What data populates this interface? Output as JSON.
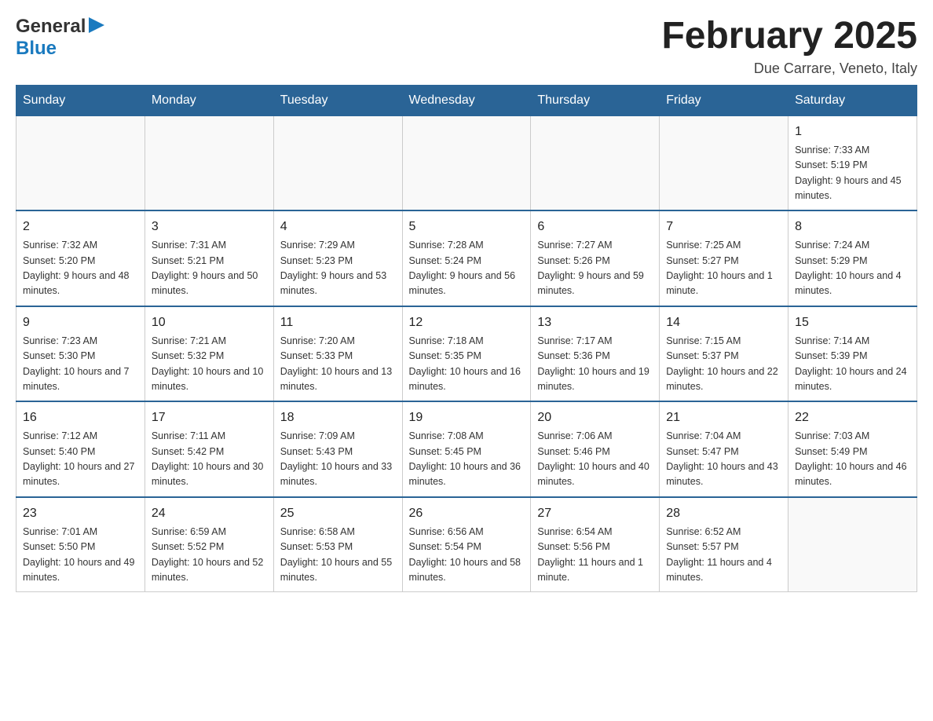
{
  "header": {
    "logo": {
      "general": "General",
      "blue": "Blue",
      "arrow": "▶"
    },
    "title": "February 2025",
    "location": "Due Carrare, Veneto, Italy"
  },
  "days_of_week": [
    "Sunday",
    "Monday",
    "Tuesday",
    "Wednesday",
    "Thursday",
    "Friday",
    "Saturday"
  ],
  "weeks": [
    [
      {
        "day": "",
        "info": ""
      },
      {
        "day": "",
        "info": ""
      },
      {
        "day": "",
        "info": ""
      },
      {
        "day": "",
        "info": ""
      },
      {
        "day": "",
        "info": ""
      },
      {
        "day": "",
        "info": ""
      },
      {
        "day": "1",
        "info": "Sunrise: 7:33 AM\nSunset: 5:19 PM\nDaylight: 9 hours and 45 minutes."
      }
    ],
    [
      {
        "day": "2",
        "info": "Sunrise: 7:32 AM\nSunset: 5:20 PM\nDaylight: 9 hours and 48 minutes."
      },
      {
        "day": "3",
        "info": "Sunrise: 7:31 AM\nSunset: 5:21 PM\nDaylight: 9 hours and 50 minutes."
      },
      {
        "day": "4",
        "info": "Sunrise: 7:29 AM\nSunset: 5:23 PM\nDaylight: 9 hours and 53 minutes."
      },
      {
        "day": "5",
        "info": "Sunrise: 7:28 AM\nSunset: 5:24 PM\nDaylight: 9 hours and 56 minutes."
      },
      {
        "day": "6",
        "info": "Sunrise: 7:27 AM\nSunset: 5:26 PM\nDaylight: 9 hours and 59 minutes."
      },
      {
        "day": "7",
        "info": "Sunrise: 7:25 AM\nSunset: 5:27 PM\nDaylight: 10 hours and 1 minute."
      },
      {
        "day": "8",
        "info": "Sunrise: 7:24 AM\nSunset: 5:29 PM\nDaylight: 10 hours and 4 minutes."
      }
    ],
    [
      {
        "day": "9",
        "info": "Sunrise: 7:23 AM\nSunset: 5:30 PM\nDaylight: 10 hours and 7 minutes."
      },
      {
        "day": "10",
        "info": "Sunrise: 7:21 AM\nSunset: 5:32 PM\nDaylight: 10 hours and 10 minutes."
      },
      {
        "day": "11",
        "info": "Sunrise: 7:20 AM\nSunset: 5:33 PM\nDaylight: 10 hours and 13 minutes."
      },
      {
        "day": "12",
        "info": "Sunrise: 7:18 AM\nSunset: 5:35 PM\nDaylight: 10 hours and 16 minutes."
      },
      {
        "day": "13",
        "info": "Sunrise: 7:17 AM\nSunset: 5:36 PM\nDaylight: 10 hours and 19 minutes."
      },
      {
        "day": "14",
        "info": "Sunrise: 7:15 AM\nSunset: 5:37 PM\nDaylight: 10 hours and 22 minutes."
      },
      {
        "day": "15",
        "info": "Sunrise: 7:14 AM\nSunset: 5:39 PM\nDaylight: 10 hours and 24 minutes."
      }
    ],
    [
      {
        "day": "16",
        "info": "Sunrise: 7:12 AM\nSunset: 5:40 PM\nDaylight: 10 hours and 27 minutes."
      },
      {
        "day": "17",
        "info": "Sunrise: 7:11 AM\nSunset: 5:42 PM\nDaylight: 10 hours and 30 minutes."
      },
      {
        "day": "18",
        "info": "Sunrise: 7:09 AM\nSunset: 5:43 PM\nDaylight: 10 hours and 33 minutes."
      },
      {
        "day": "19",
        "info": "Sunrise: 7:08 AM\nSunset: 5:45 PM\nDaylight: 10 hours and 36 minutes."
      },
      {
        "day": "20",
        "info": "Sunrise: 7:06 AM\nSunset: 5:46 PM\nDaylight: 10 hours and 40 minutes."
      },
      {
        "day": "21",
        "info": "Sunrise: 7:04 AM\nSunset: 5:47 PM\nDaylight: 10 hours and 43 minutes."
      },
      {
        "day": "22",
        "info": "Sunrise: 7:03 AM\nSunset: 5:49 PM\nDaylight: 10 hours and 46 minutes."
      }
    ],
    [
      {
        "day": "23",
        "info": "Sunrise: 7:01 AM\nSunset: 5:50 PM\nDaylight: 10 hours and 49 minutes."
      },
      {
        "day": "24",
        "info": "Sunrise: 6:59 AM\nSunset: 5:52 PM\nDaylight: 10 hours and 52 minutes."
      },
      {
        "day": "25",
        "info": "Sunrise: 6:58 AM\nSunset: 5:53 PM\nDaylight: 10 hours and 55 minutes."
      },
      {
        "day": "26",
        "info": "Sunrise: 6:56 AM\nSunset: 5:54 PM\nDaylight: 10 hours and 58 minutes."
      },
      {
        "day": "27",
        "info": "Sunrise: 6:54 AM\nSunset: 5:56 PM\nDaylight: 11 hours and 1 minute."
      },
      {
        "day": "28",
        "info": "Sunrise: 6:52 AM\nSunset: 5:57 PM\nDaylight: 11 hours and 4 minutes."
      },
      {
        "day": "",
        "info": ""
      }
    ]
  ]
}
